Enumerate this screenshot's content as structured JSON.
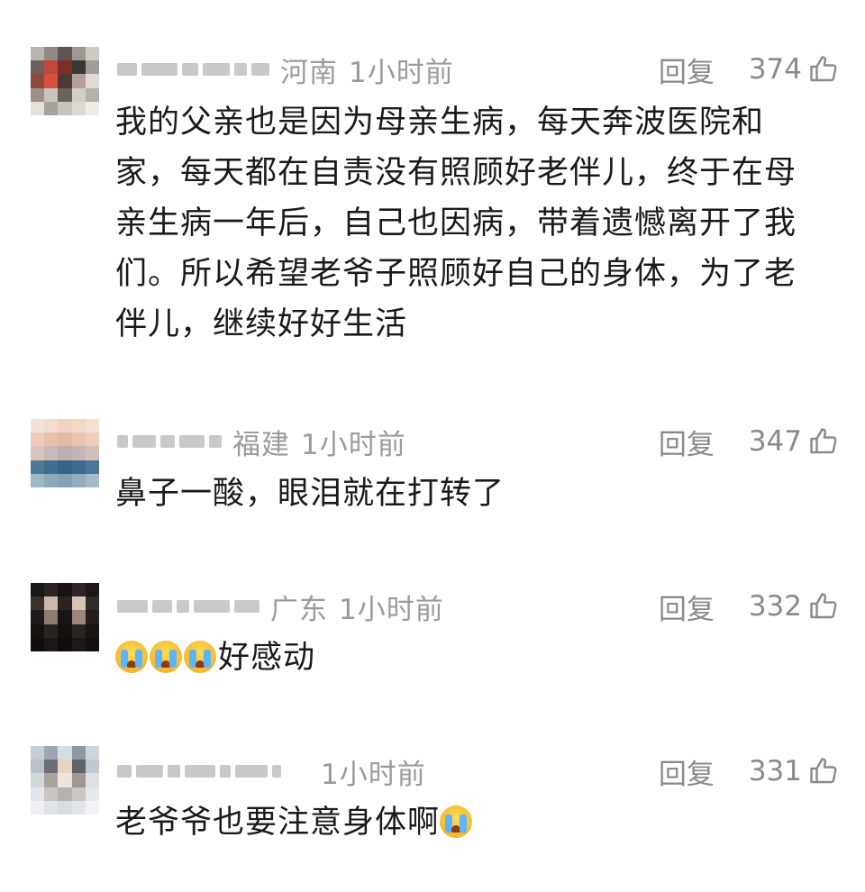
{
  "comments": [
    {
      "avatar_colors": [
        "#b9b5ae",
        "#8f8a86",
        "#5e5552",
        "#9d9893",
        "#cfcac4",
        "#6e5f5a",
        "#c2473a",
        "#7c2f27",
        "#3c3634",
        "#a39d99",
        "#8a4a3e",
        "#d8503e",
        "#4a3a36",
        "#b39f99",
        "#e0dbd6",
        "#9c8f8a",
        "#c9c3bd",
        "#6a625e",
        "#d4cfc9",
        "#b6b1ab",
        "#e4e0dc",
        "#a8a29d",
        "#cac4bf",
        "#dcd8d3",
        "#f0ece8"
      ],
      "location": "河南",
      "time": "1小时前",
      "reply_label": "回复",
      "likes": "374",
      "text": "我的父亲也是因为母亲生病，每天奔波医院和家，每天都在自责没有照顾好老伴儿，终于在母亲生病一年后，自己也因病，带着遗憾离开了我们。所以希望老爷子照顾好自己的身体，为了老伴儿，继续好好生活"
    },
    {
      "avatar_colors": [
        "#f4e3d7",
        "#f2dccd",
        "#efd4c3",
        "#f1d9ca",
        "#f3e0d3",
        "#eccbb9",
        "#e8c1ad",
        "#e5baa5",
        "#e9c4b1",
        "#edcdbb",
        "#d9c4c0",
        "#c9b8b8",
        "#b9aeb2",
        "#c4b6b7",
        "#d2bebb",
        "#4e7a9a",
        "#3f6d8f",
        "#356486",
        "#3d6a8c",
        "#4a7697",
        "#9fb6c6",
        "#8fa9bc",
        "#86a1b5",
        "#93acbe",
        "#a5bbca"
      ],
      "location": "福建",
      "time": "1小时前",
      "reply_label": "回复",
      "likes": "347",
      "text": "鼻子一酸，眼泪就在打转了"
    },
    {
      "avatar_colors": [
        "#1b1717",
        "#2c2524",
        "#171313",
        "#2e2726",
        "#1d1818",
        "#3a302e",
        "#c9b9a8",
        "#2a2322",
        "#d6c5b2",
        "#332b2a",
        "#201a1a",
        "#8d7b6d",
        "#1a1515",
        "#9a887a",
        "#241e1d",
        "#151111",
        "#2a2322",
        "#131010",
        "#2b2423",
        "#181414",
        "#100d0d",
        "#1c1717",
        "#0f0c0c",
        "#1d1818",
        "#110e0e"
      ],
      "location": "广东",
      "time": "1小时前",
      "reply_label": "回复",
      "likes": "332",
      "text": "好感动"
    },
    {
      "avatar_colors": [
        "#c7cdd4",
        "#9ea7b1",
        "#d8dde2",
        "#8d96a1",
        "#cfd4da",
        "#b8c0c8",
        "#6d6f74",
        "#e5d3c4",
        "#5f6267",
        "#c1c8cf",
        "#d2d7dc",
        "#a9a39f",
        "#f0e3d8",
        "#9e9893",
        "#dde1e5",
        "#e3e6e9",
        "#c9c5c2",
        "#b7b1ad",
        "#cbc7c4",
        "#e6e9ec",
        "#eef0f2",
        "#e1e4e7",
        "#d9dcdf",
        "#e4e7ea",
        "#f1f3f5"
      ],
      "location": "",
      "time": "1小时前",
      "reply_label": "回复",
      "likes": "331",
      "text": "老爷爷也要注意身体啊"
    }
  ],
  "icons": {
    "like": "thumbs-up-icon",
    "emoji": "loudly-crying-face-icon"
  }
}
